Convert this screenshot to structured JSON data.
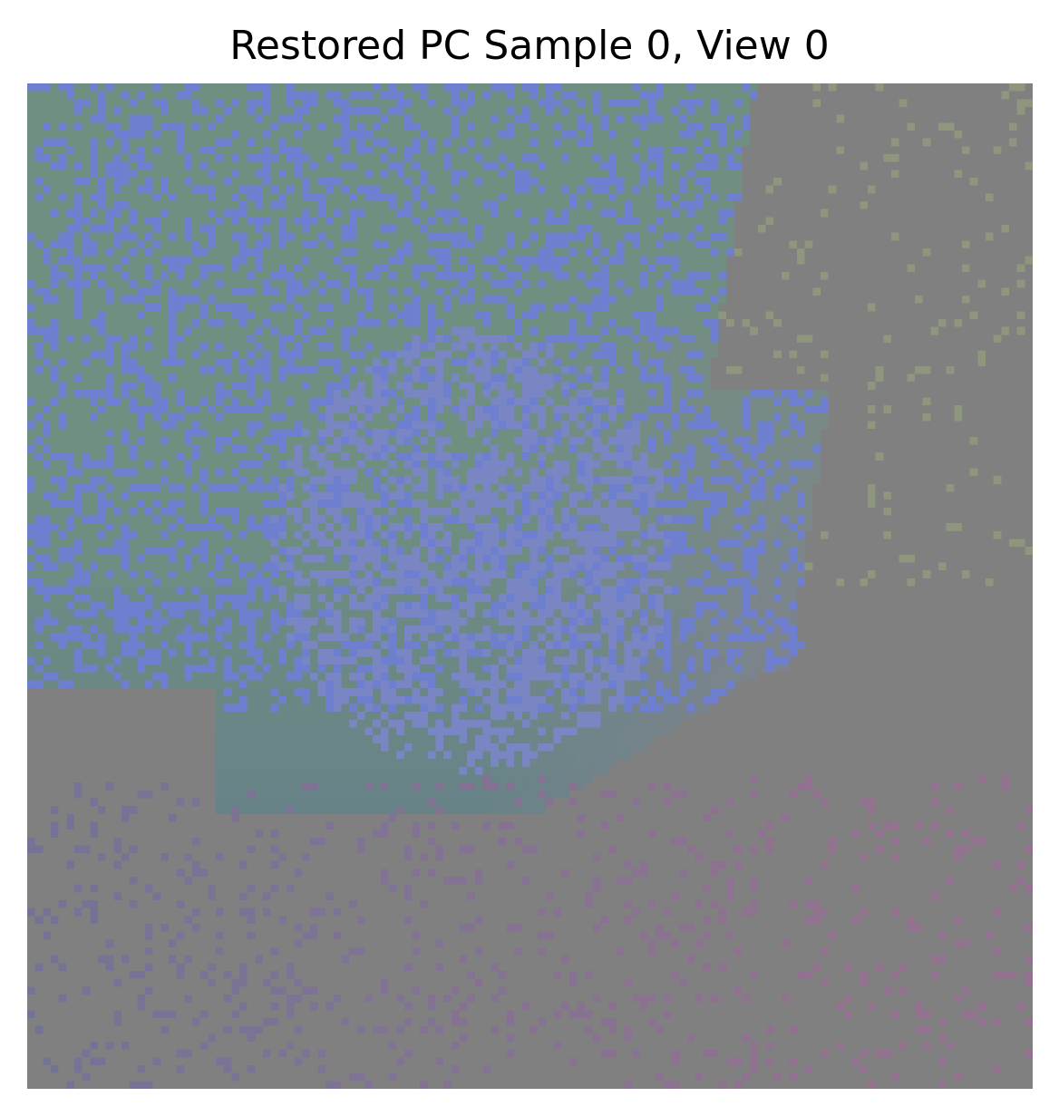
{
  "figure": {
    "title": "Restored PC Sample 0, View 0"
  },
  "image": {
    "description_kind": "point-cloud normal map render",
    "grid_resolution": 128,
    "background_color": "#808080",
    "palette": {
      "green_region": "#6f8f80",
      "blue_region": "#7a86c4",
      "blue_dots": "#6f7fd0",
      "teal_region": "#66808a",
      "purple_region": "#8a7f92",
      "pink_dots": "#93728f",
      "olive_dots": "#8e967e"
    }
  }
}
